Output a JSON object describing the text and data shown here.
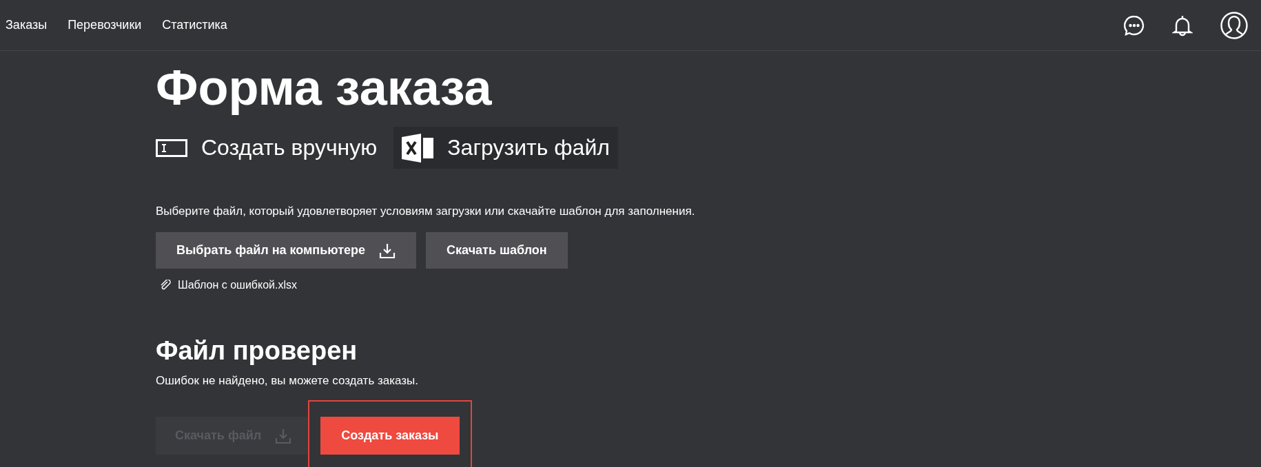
{
  "nav": {
    "items": [
      {
        "label": "Заказы"
      },
      {
        "label": "Перевозчики"
      },
      {
        "label": "Статистика"
      }
    ]
  },
  "title": "Форма заказа",
  "mode_tabs": [
    {
      "label": "Создать вручную",
      "kind": "manual",
      "selected": false
    },
    {
      "label": "Загрузить файл",
      "kind": "upload",
      "selected": true
    }
  ],
  "instructions": "Выберите файл, который удовлетворяет условиям загрузки или скачайте шаблон для заполнения.",
  "file_buttons": [
    {
      "label": "Выбрать файл на компьютере",
      "kind": "upload"
    },
    {
      "label": "Скачать шаблон",
      "kind": "template"
    }
  ],
  "attachment": {
    "file_name": "Шаблон с ошибкой.xlsx"
  },
  "result": {
    "title": "Файл проверен",
    "message": "Ошибок не найдено, вы можете создать заказы."
  },
  "actions": [
    {
      "label": "Скачать файл",
      "kind": "secondary",
      "disabled": true,
      "highlighted": false
    },
    {
      "label": "Создать заказы",
      "kind": "primary",
      "disabled": false,
      "highlighted": true
    }
  ]
}
